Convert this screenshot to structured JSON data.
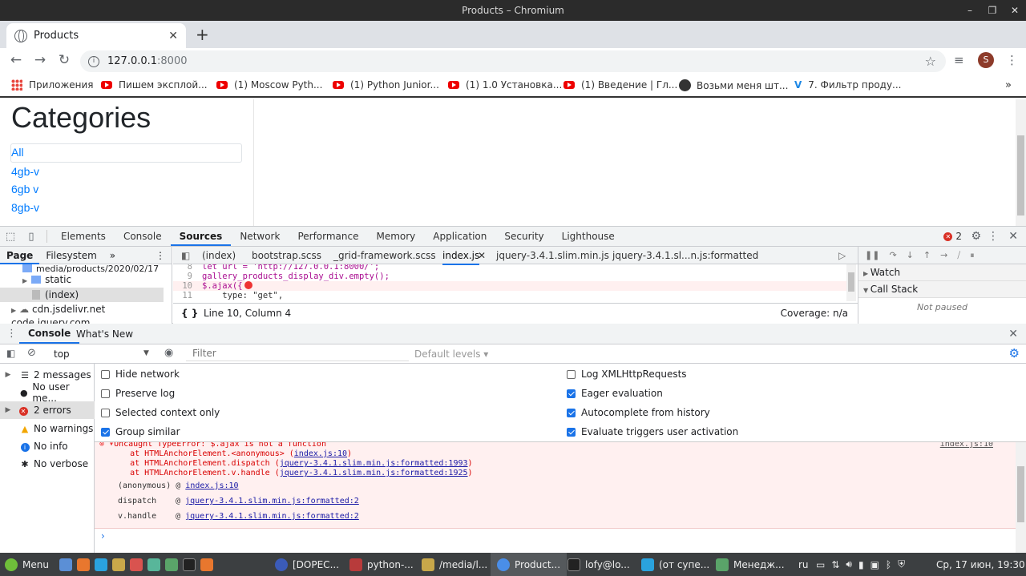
{
  "window": {
    "title": "Products – Chromium"
  },
  "tab": {
    "title": "Products"
  },
  "address": {
    "host": "127.0.0.1",
    "port": ":8000"
  },
  "profile": {
    "initial": "S"
  },
  "bookmarks": [
    {
      "label": "Приложения",
      "icon": "apps-icon"
    },
    {
      "label": "Пишем эксплой...",
      "icon": "youtube-icon"
    },
    {
      "label": "(1) Moscow Pyth...",
      "icon": "youtube-icon"
    },
    {
      "label": "(1) Python Junior...",
      "icon": "youtube-icon"
    },
    {
      "label": "(1) 1.0 Установка...",
      "icon": "youtube-icon"
    },
    {
      "label": "(1) Введение | Гл...",
      "icon": "youtube-icon"
    },
    {
      "label": "Возьми меня шт...",
      "icon": "avatar-icon"
    },
    {
      "label": "7. Фильтр проду...",
      "icon": "v-icon"
    }
  ],
  "page": {
    "heading": "Categories",
    "categories": [
      "All",
      "4gb-v",
      "6gb v",
      "8gb-v"
    ]
  },
  "devtools": {
    "tabs": [
      "Elements",
      "Console",
      "Sources",
      "Network",
      "Performance",
      "Memory",
      "Application",
      "Security",
      "Lighthouse"
    ],
    "active_tab": "Sources",
    "error_count": "2",
    "navigator_tabs": [
      "Page",
      "Filesystem"
    ],
    "tree": [
      "media/products/2020/02/17",
      "static",
      "(index)",
      "cdn.jsdelivr.net",
      "code.jquery.com"
    ],
    "editor_tabs": [
      "(index)",
      "bootstrap.scss",
      "_grid-framework.scss",
      "index.js",
      "jquery-3.4.1.slim.min.js",
      "jquery-3.4.1.sl...n.js:formatted"
    ],
    "code": [
      {
        "n": "8",
        "text": "let url = 'http://127.0.0.1:8000/';"
      },
      {
        "n": "9",
        "text": "gallery_products_display_div.empty();"
      },
      {
        "n": "10",
        "text": "$.ajax({"
      },
      {
        "n": "11",
        "text": "    type: \"get\","
      }
    ],
    "position": "Line 10, Column 4",
    "coverage": "Coverage: n/a",
    "watch": "Watch",
    "callstack": "Call Stack",
    "not_paused": "Not paused",
    "drawer_tabs": [
      "Console",
      "What's New"
    ],
    "context": "top",
    "filter_placeholder": "Filter",
    "levels": "Default levels ▾",
    "sidebar": [
      {
        "label": "2 messages",
        "icon": "list-icon"
      },
      {
        "label": "No user me...",
        "icon": "user-icon"
      },
      {
        "label": "2 errors",
        "icon": "error-icon"
      },
      {
        "label": "No warnings",
        "icon": "warning-icon"
      },
      {
        "label": "No info",
        "icon": "info-icon"
      },
      {
        "label": "No verbose",
        "icon": "bug-icon"
      }
    ],
    "settings_left": [
      {
        "label": "Hide network",
        "checked": false
      },
      {
        "label": "Preserve log",
        "checked": false
      },
      {
        "label": "Selected context only",
        "checked": false
      },
      {
        "label": "Group similar",
        "checked": true
      }
    ],
    "settings_right": [
      {
        "label": "Log XMLHttpRequests",
        "checked": false
      },
      {
        "label": "Eager evaluation",
        "checked": true
      },
      {
        "label": "Autocomplete from history",
        "checked": true
      },
      {
        "label": "Evaluate triggers user activation",
        "checked": true
      }
    ],
    "error": {
      "message": "Uncaught TypeError: $.ajax is not a function",
      "source": "index.js:10",
      "stack": [
        {
          "prefix": "    at HTMLAnchorElement.<anonymous> (",
          "link": "index.js:10",
          "suffix": ")"
        },
        {
          "prefix": "    at HTMLAnchorElement.dispatch (",
          "link": "jquery-3.4.1.slim.min.js:formatted:1993",
          "suffix": ")"
        },
        {
          "prefix": "    at HTMLAnchorElement.v.handle (",
          "link": "jquery-3.4.1.slim.min.js:formatted:1925",
          "suffix": ")"
        }
      ],
      "frames": [
        {
          "fn": "(anonymous)",
          "link": "index.js:10"
        },
        {
          "fn": "dispatch",
          "link": "jquery-3.4.1.slim.min.js:formatted:2"
        },
        {
          "fn": "v.handle",
          "link": "jquery-3.4.1.slim.min.js:formatted:2"
        }
      ]
    }
  },
  "taskbar": {
    "menu": "Menu",
    "items": [
      "[DOPEC...",
      "python-...",
      "/media/l...",
      "Product...",
      "lofy@lo...",
      "(от супе...",
      "Менедж..."
    ],
    "lang": "ru",
    "clock": "Ср, 17 июн, 19:30"
  }
}
